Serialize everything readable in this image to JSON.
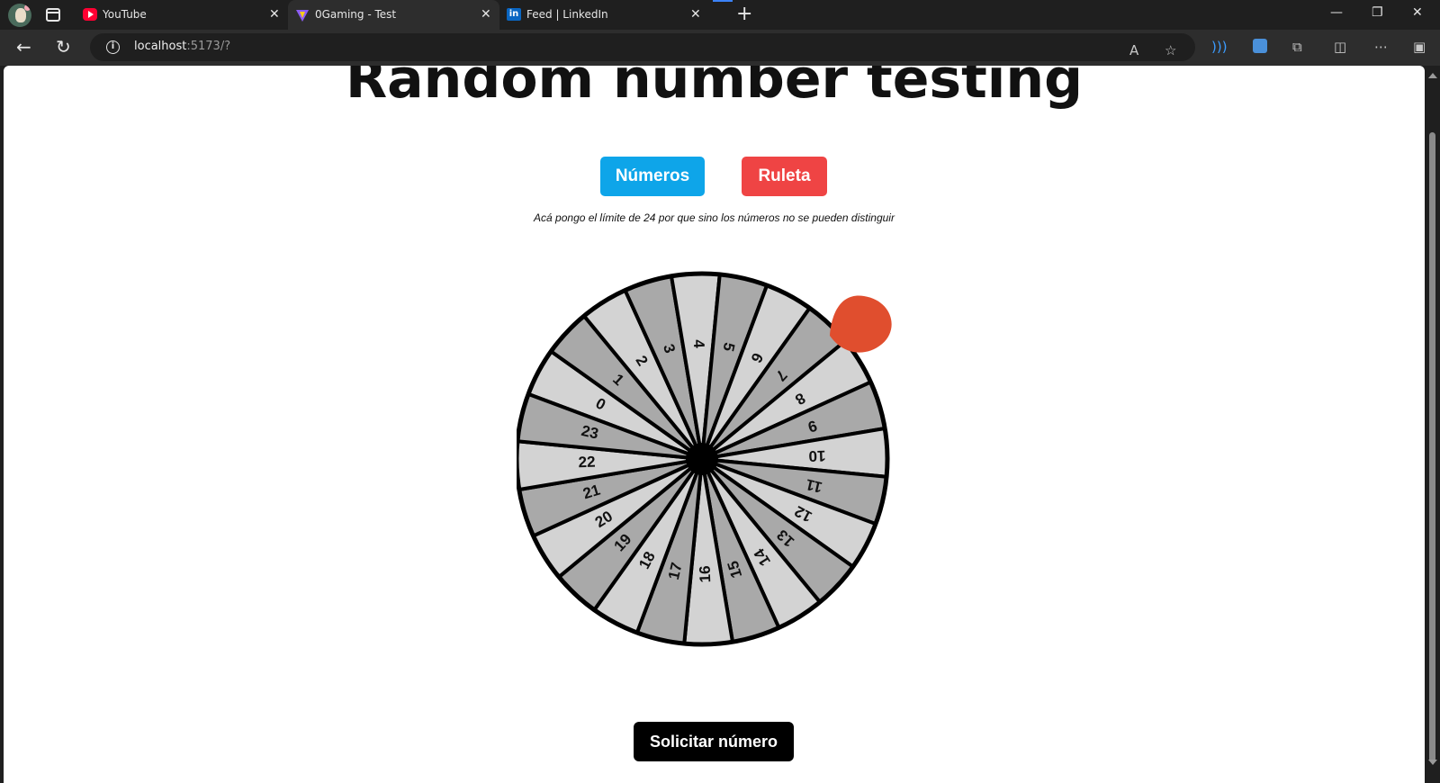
{
  "browser": {
    "tabs": [
      {
        "title": "YouTube",
        "favicon": "youtube-icon",
        "active": false
      },
      {
        "title": "0Gaming - Test",
        "favicon": "vite-icon",
        "active": true
      },
      {
        "title": "Feed | LinkedIn",
        "favicon": "linkedin-icon",
        "active": false
      }
    ],
    "address": {
      "host": "localhost",
      "rest": ":5173/?"
    }
  },
  "page": {
    "title": "Random number testing",
    "buttons": {
      "numbers": "Números",
      "roulette": "Ruleta",
      "request": "Solicitar número"
    },
    "note": "Acá pongo el límite de 24 por que sino los números no se pueden distinguir"
  },
  "wheel": {
    "labels": [
      "0",
      "1",
      "2",
      "3",
      "4",
      "5",
      "6",
      "7",
      "8",
      "9",
      "10",
      "11",
      "12",
      "13",
      "14",
      "15",
      "16",
      "17",
      "18",
      "19",
      "20",
      "21",
      "22",
      "23"
    ],
    "colors": {
      "light": "#d3d3d3",
      "dark": "#a9a9a9",
      "border": "#000000",
      "pointer": "#e04e2e"
    }
  },
  "colors": {
    "numbers_btn": "#0ea5e9",
    "roulette_btn": "#ef4444",
    "request_btn": "#000000"
  }
}
